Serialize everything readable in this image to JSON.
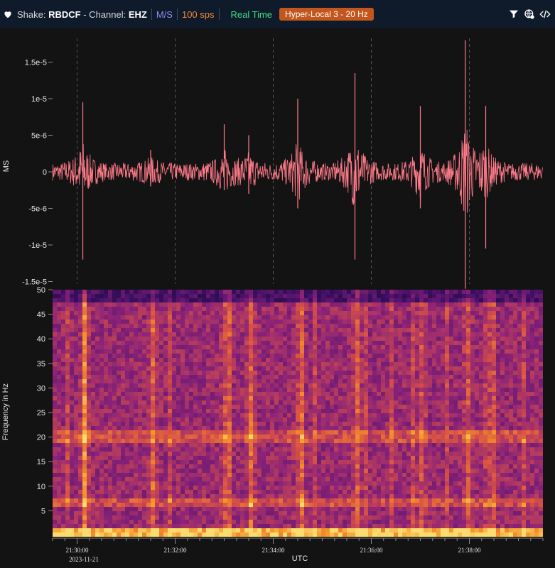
{
  "header": {
    "shake_prefix": "Shake:",
    "station": "RBDCF",
    "channel_prefix": "- Channel:",
    "channel": "EHZ",
    "units": "M/S",
    "sps": "100 sps",
    "mode": "Real Time",
    "filter": "Hyper-Local 3 - 20 Hz"
  },
  "icons": [
    "heart-icon",
    "filter-icon",
    "globe-gear-icon",
    "code-icon"
  ],
  "colors": {
    "header_bg": "#0f1a2b",
    "trace": "#ff7b8a",
    "units": "#8f8cf0",
    "sps": "#f28a3c",
    "realtime": "#3fe07d",
    "filter_bg": "#c2561c"
  },
  "chart_data": [
    {
      "type": "line",
      "title": "",
      "ylabel": "MS",
      "ylim": [
        -1.5e-05,
        1.5e-05
      ],
      "y_ticks": [
        {
          "value": 1.5e-05,
          "label": "1.5e-5"
        },
        {
          "value": 1e-05,
          "label": "1e-5"
        },
        {
          "value": 5e-06,
          "label": "5e-6"
        },
        {
          "value": 0,
          "label": "0"
        },
        {
          "value": -5e-06,
          "label": "-5e-6"
        },
        {
          "value": -1e-05,
          "label": "-1e-5"
        },
        {
          "value": -1.5e-05,
          "label": "-1.5e-5"
        }
      ],
      "x_range": [
        "21:29:30",
        "21:39:30"
      ],
      "series": [
        {
          "peaks": [
            {
              "t": "21:30:07",
              "max": 9.5e-06,
              "min": -1.2e-05
            },
            {
              "t": "21:31:30",
              "max": 3e-06,
              "min": -2e-06
            },
            {
              "t": "21:33:00",
              "max": 6.5e-06,
              "min": -2.5e-06
            },
            {
              "t": "21:33:30",
              "max": 5e-06,
              "min": -3e-06
            },
            {
              "t": "21:34:30",
              "max": 1e-05,
              "min": -5e-06
            },
            {
              "t": "21:35:40",
              "max": 1.35e-05,
              "min": -1.2e-05
            },
            {
              "t": "21:37:00",
              "max": 9e-06,
              "min": -5e-06
            },
            {
              "t": "21:37:55",
              "max": 1.8e-05,
              "min": -1.6e-05
            },
            {
              "t": "21:38:20",
              "max": 9e-06,
              "min": -1.05e-05
            }
          ]
        }
      ]
    },
    {
      "type": "heatmap",
      "ylabel": "Frequency in Hz",
      "ylim": [
        0,
        50
      ],
      "y_ticks": [
        5,
        10,
        15,
        20,
        25,
        30,
        35,
        40,
        45,
        50
      ],
      "xlabel": "UTC",
      "x_ticks": [
        "21:30:00",
        "21:32:00",
        "21:34:00",
        "21:36:00",
        "21:38:00"
      ],
      "date": "2023-11-21",
      "bands_hz": [
        1,
        7,
        20.5
      ],
      "colormap": "inferno"
    }
  ]
}
